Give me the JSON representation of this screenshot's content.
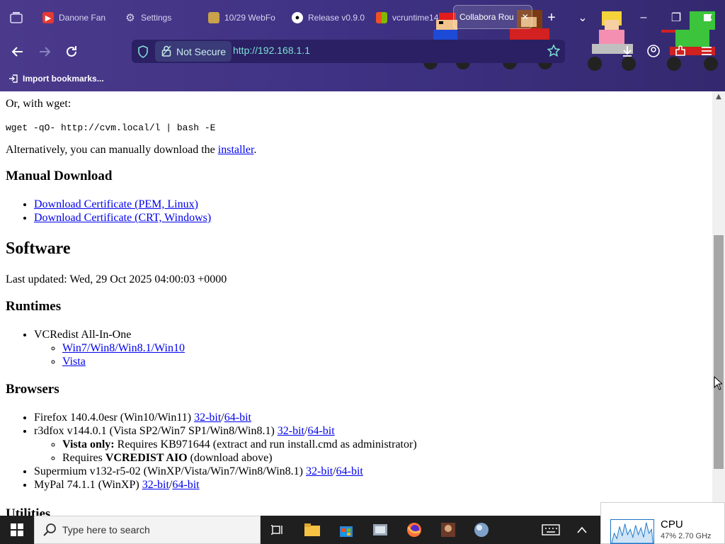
{
  "tabs": [
    {
      "label": "Danone Fan",
      "icon": "youtube-icon",
      "color": "#e53935"
    },
    {
      "label": "Settings",
      "icon": "gear-icon",
      "color": "#d9d4f2"
    },
    {
      "label": "10/29 WebFo",
      "icon": "page-icon",
      "color": "#c9a24a"
    },
    {
      "label": "Release v0.9.0",
      "icon": "github-icon",
      "color": "#ffffff"
    },
    {
      "label": "vcruntime14",
      "icon": "windows-store-icon",
      "color": "#f25022"
    },
    {
      "label": "Collabora Rou",
      "icon": "page-icon",
      "color": "#ffffff",
      "active": true
    }
  ],
  "navbar": {
    "security_label": "Not Secure",
    "url": "http://192.168.1.1"
  },
  "bookmarks": {
    "import_label": "Import bookmarks..."
  },
  "page": {
    "wget_intro": "Or, with wget:",
    "wget_cmd": "wget -qO- http://cvm.local/l | bash -E",
    "alt_text": "Alternatively, you can manually download the ",
    "installer_link": "installer",
    "period": ".",
    "manual_heading": "Manual Download",
    "cert_links": [
      "Download Certificate (PEM, Linux)",
      "Download Certificate (CRT, Windows)"
    ],
    "software_heading": "Software",
    "last_updated": "Last updated: Wed, 29 Oct 2025 04:00:03 +0000",
    "runtimes_heading": "Runtimes",
    "vcredist": "VCRedist All-In-One",
    "vcredist_links": [
      "Win7/Win8/Win8.1/Win10",
      "Vista"
    ],
    "browsers_heading": "Browsers",
    "firefox": "Firefox 140.4.0esr (Win10/Win11) ",
    "r3dfox": "r3dfox v144.0.1 (Vista SP2/Win7 SP1/Win8/Win8.1) ",
    "vista_only_bold": "Vista only:",
    "vista_only_rest": " Requires KB971644 (extract and run install.cmd as administrator)",
    "requires_pre": "Requires ",
    "requires_bold": "VCREDIST AIO",
    "requires_post": " (download above)",
    "supermium": "Supermium v132-r5-02 (WinXP/Vista/Win7/Win8/Win8.1) ",
    "mypal": "MyPal 74.1.1 (WinXP) ",
    "bit32": "32-bit",
    "bit64": "64-bit",
    "slash": "/",
    "utilities_heading": "Utilities"
  },
  "taskbar": {
    "search_placeholder": "Type here to search"
  },
  "cpu": {
    "title": "CPU",
    "detail": "47% 2.70 GHz"
  },
  "colors": {
    "chrome_bg": "#3e3183",
    "url_text": "#7fe0d6",
    "link": "#0000ee",
    "taskbar": "#1f1f1f"
  }
}
